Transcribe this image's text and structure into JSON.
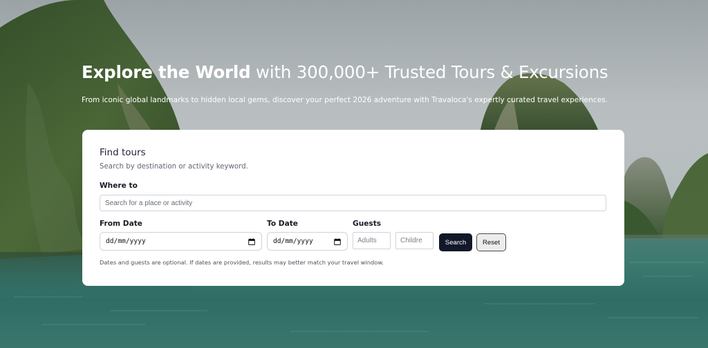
{
  "hero": {
    "title_bold": "Explore the World",
    "title_rest": " with 300,000+ Trusted Tours & Excursions",
    "subtitle": "From iconic global landmarks to hidden local gems, discover your perfect 2026 adventure with Travaloca's expertly curated travel experiences."
  },
  "search_card": {
    "title": "Find tours",
    "description": "Search by destination or activity keyword.",
    "where_label": "Where to",
    "where_placeholder": "Search for a place or activity",
    "from_label": "From Date",
    "from_value": "dd/mm/yyyy",
    "to_label": "To Date",
    "to_value": "dd/mm/yyyy",
    "guests_label": "Guests",
    "adults_placeholder": "Adults",
    "children_placeholder": "Childre",
    "search_button": "Search",
    "reset_button": "Reset",
    "note": "Dates and guests are optional. If dates are provided, results may better match your travel window."
  },
  "icons": {
    "date_picker": "calendar-icon"
  },
  "colors": {
    "primary_button": "#12182a",
    "card_background": "#ffffff",
    "hero_text": "#ffffff"
  }
}
